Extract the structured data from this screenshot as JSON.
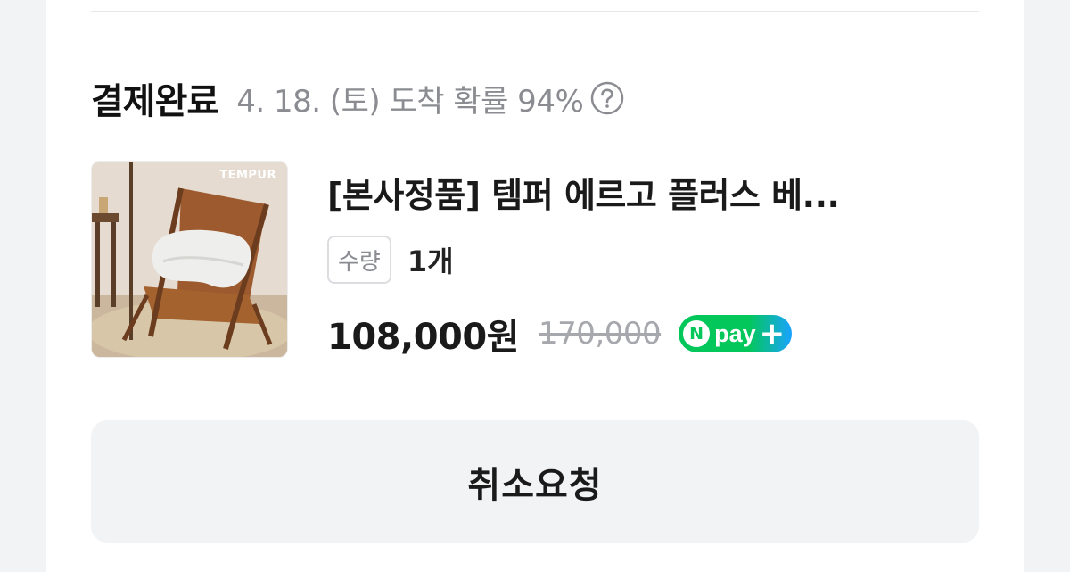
{
  "order": {
    "status": "결제완료",
    "eta": "4. 18. (토) 도착 확률 94%",
    "help_icon": "question-circle-icon"
  },
  "product": {
    "brand": "TEMPUR",
    "name": "[본사정품] 템퍼 에르고 플러스 베...",
    "quantity_label": "수량",
    "quantity_value": "1개",
    "price": "108,000원",
    "original_price": "170,000",
    "npay_badge": {
      "n": "N",
      "text": "pay",
      "plus": "+"
    }
  },
  "actions": {
    "cancel_label": "취소요청"
  },
  "colors": {
    "npay_green": "#03c75a",
    "npay_blue": "#1aa3ff",
    "muted_text": "#8a8c91",
    "button_bg": "#f2f3f5"
  }
}
